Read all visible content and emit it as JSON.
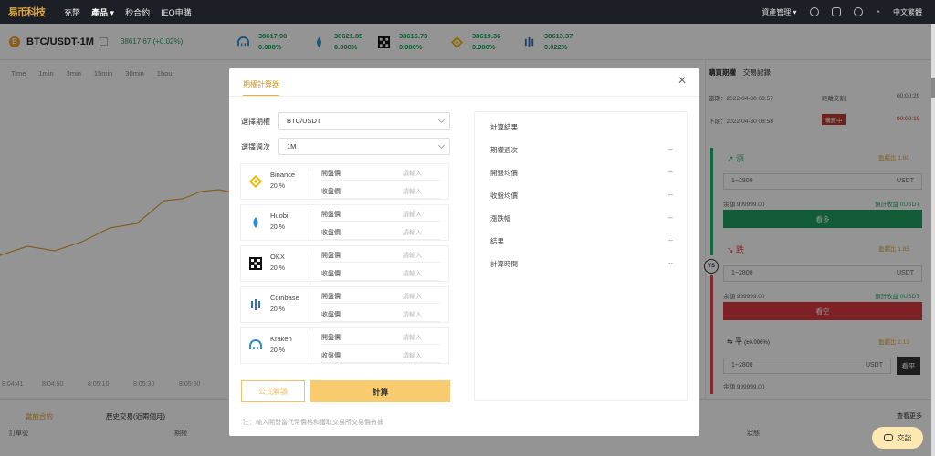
{
  "nav": {
    "logo": "易币科技",
    "items": [
      "充幣",
      "產品",
      "秒合約",
      "IEO申購"
    ],
    "right": {
      "assets": "資產管理",
      "language": "中文繁體"
    }
  },
  "ticker": {
    "coin_symbol": "B",
    "pair": "BTC/USDT-1M",
    "price": "38617.67",
    "change": "(+0.02%)",
    "exchanges": [
      {
        "price": "38617.90",
        "pct": "0.008%"
      },
      {
        "price": "38621.85",
        "pct": "0.008%"
      },
      {
        "price": "38615.73",
        "pct": "0.000%"
      },
      {
        "price": "38619.36",
        "pct": "0.000%"
      },
      {
        "price": "38613.37",
        "pct": "0.022%"
      }
    ]
  },
  "chart": {
    "timeframes": [
      "Time",
      "1min",
      "3min",
      "15min",
      "30min",
      "1hour"
    ],
    "time_axis": [
      "8:04:41",
      "8:04:50",
      "8:05:10",
      "8:05:30",
      "8:05:50"
    ]
  },
  "right_panel": {
    "tab_active": "購買期權",
    "tab_other": "交易記錄",
    "current_label": "當期：",
    "current_time": "2022-04-30 08:57",
    "current_status": "距離交割",
    "current_countdown": "00:00:29",
    "next_label": "下期：",
    "next_time": "2022-04-30 08:58",
    "next_status": "購買中",
    "next_countdown": "00:00:19",
    "rise_label": "漲",
    "fall_label": "跌",
    "flat_label": "平",
    "flat_range": "(±0.006%)",
    "rise_payout": "盈虧比 1.80",
    "fall_payout": "盈虧比 1.85",
    "flat_payout": "盈虧比 2.13",
    "input_placeholder": "1~2800",
    "unit": "USDT",
    "balance": "余額 999999.00",
    "expected": "預計收益 0USDT",
    "buy_rise": "看多",
    "buy_fall": "看空",
    "buy_flat": "看平",
    "vs": "VS"
  },
  "bottom": {
    "tabs": [
      "當前合約",
      "歷史交易(近兩個月)"
    ],
    "more": "查看更多",
    "cols": [
      "訂單號",
      "期權",
      "狀態"
    ]
  },
  "modal": {
    "tab": "期權計算器",
    "label_option": "選擇期權",
    "option_value": "BTC/USDT",
    "label_period": "選擇週次",
    "period_value": "1M",
    "open_label": "開盤價",
    "close_label": "收盤價",
    "placeholder": "請輸入",
    "exchanges": [
      {
        "name": "Binance",
        "pct": "20 %"
      },
      {
        "name": "Huobi",
        "pct": "20 %"
      },
      {
        "name": "OKX",
        "pct": "20 %"
      },
      {
        "name": "Coinbase",
        "pct": "20 %"
      },
      {
        "name": "Kraken",
        "pct": "20 %"
      }
    ],
    "formula_btn": "公式解讀",
    "calc_btn": "計算",
    "note": "注：輸入開發當代幣價格和獲取交易所交易價數據",
    "result": {
      "title": "計算結果",
      "rows": [
        {
          "label": "期權週次",
          "value": "--"
        },
        {
          "label": "開盤均價",
          "value": "--"
        },
        {
          "label": "收盤均價",
          "value": "--"
        },
        {
          "label": "漲跌幅",
          "value": "--"
        },
        {
          "label": "結果",
          "value": "--"
        },
        {
          "label": "計算時間",
          "value": "--"
        }
      ]
    }
  },
  "chat": {
    "label": "交談"
  }
}
